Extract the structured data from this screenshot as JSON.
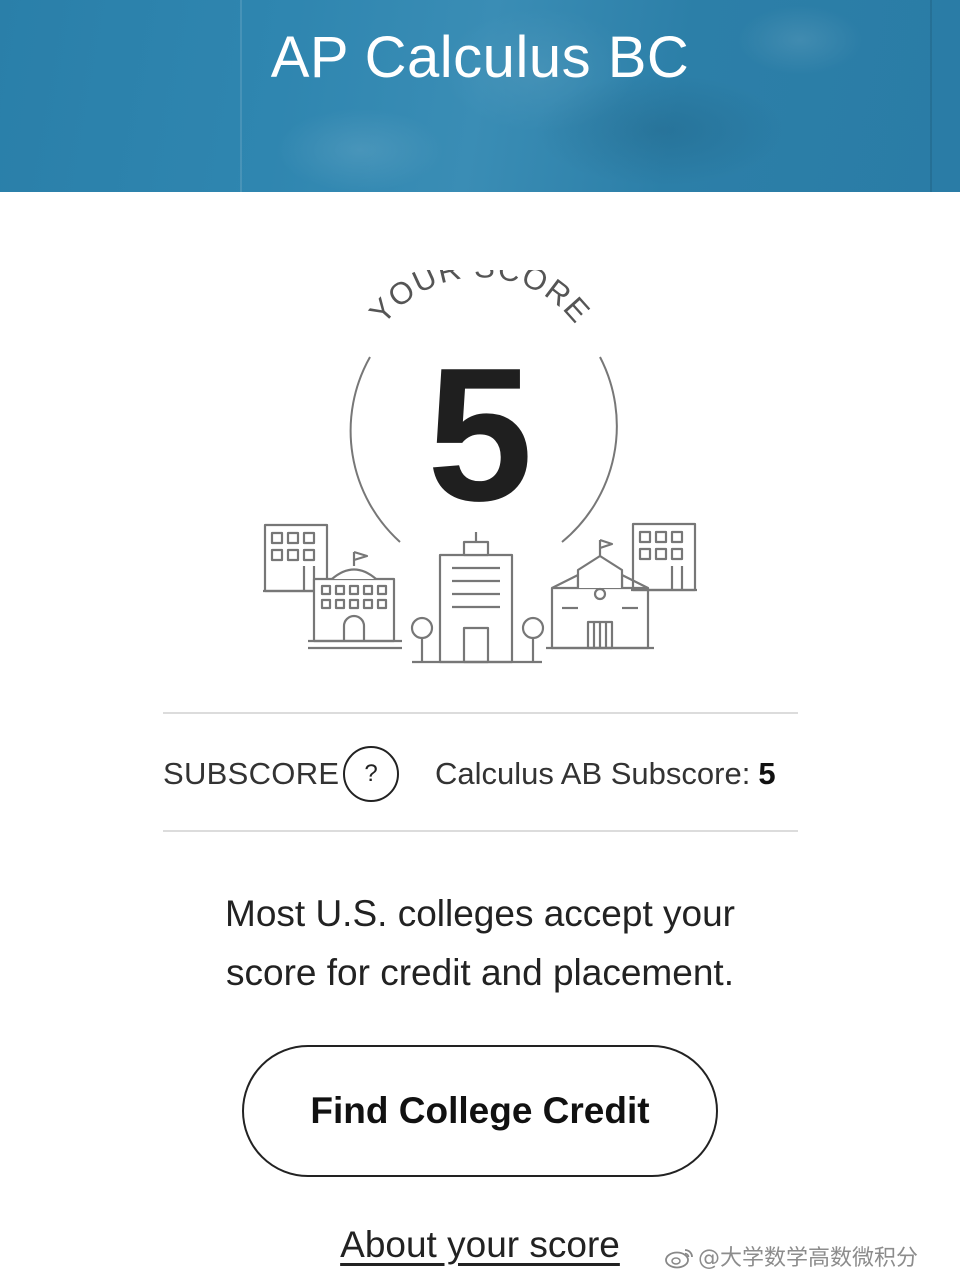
{
  "header": {
    "title": "AP Calculus BC",
    "background_color": "#2f84ad"
  },
  "score_badge": {
    "caption": "YOUR SCORE",
    "score": "5"
  },
  "subscore": {
    "label": "SUBSCORE",
    "help_symbol": "?",
    "name": "Calculus AB Subscore:",
    "value": "5"
  },
  "message": {
    "line1": "Most U.S. colleges accept your",
    "line2": "score for credit and placement."
  },
  "actions": {
    "primary_label": "Find College Credit",
    "secondary_link": "About your score"
  },
  "watermark": {
    "text": "@大学数学高数微积分"
  },
  "icons": [
    "college-buildings-icon",
    "weibo-logo-icon"
  ]
}
